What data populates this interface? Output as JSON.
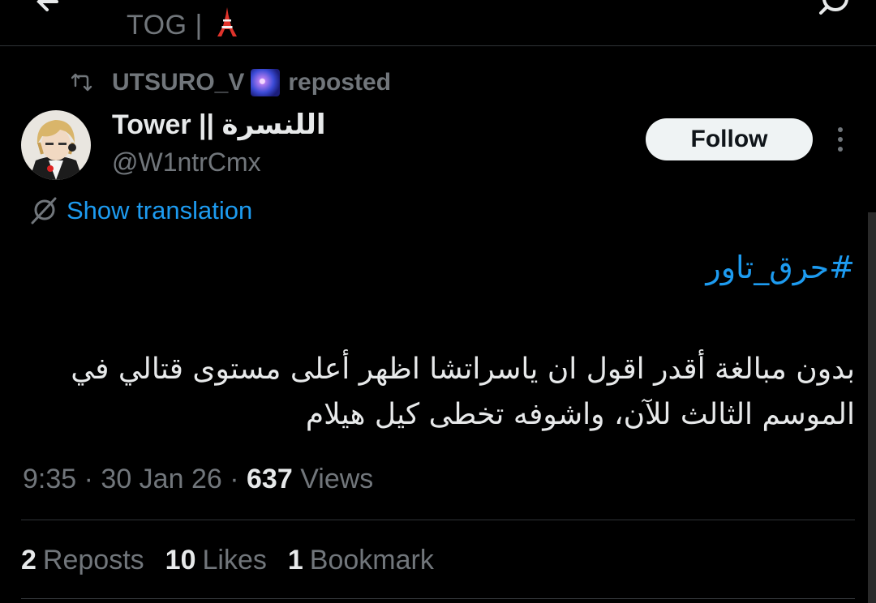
{
  "header": {
    "tab_label": "TOG |"
  },
  "repost": {
    "username": "UTSURO_V",
    "label": "reposted"
  },
  "author": {
    "name": "Tower || اللنسرة",
    "handle": "@W1ntrCmx"
  },
  "follow_label": "Follow",
  "translation_label": "Show translation",
  "tweet": {
    "hashtag": "#حرق_تاور",
    "body_line1": "بدون مبالغة أقدر اقول ان ياسراتشا اظهر أعلى مستوى قتالي في",
    "body_line2": "الموسم الثالث للآن، واشوفه تخطى كيل هيلام"
  },
  "meta": {
    "time": "9:35",
    "date": "30 Jan 26",
    "views_count": "637",
    "views_label": "Views"
  },
  "stats": {
    "reposts_count": "2",
    "reposts_label": "Reposts",
    "likes_count": "10",
    "likes_label": "Likes",
    "bookmarks_count": "1",
    "bookmarks_label": "Bookmark"
  },
  "colors": {
    "background": "#000000",
    "text_primary": "#e7e9ea",
    "text_secondary": "#71767b",
    "link_blue": "#1d9bf0",
    "follow_bg": "#eff3f4",
    "divider": "#2f3336"
  },
  "icons": {
    "back": "arrow-left-icon",
    "search": "search-icon",
    "repost": "repost-icon",
    "more": "more-vertical-icon",
    "translate": "translate-icon",
    "tower": "tokyo-tower-emoji",
    "galaxy": "milky-way-emoji"
  }
}
